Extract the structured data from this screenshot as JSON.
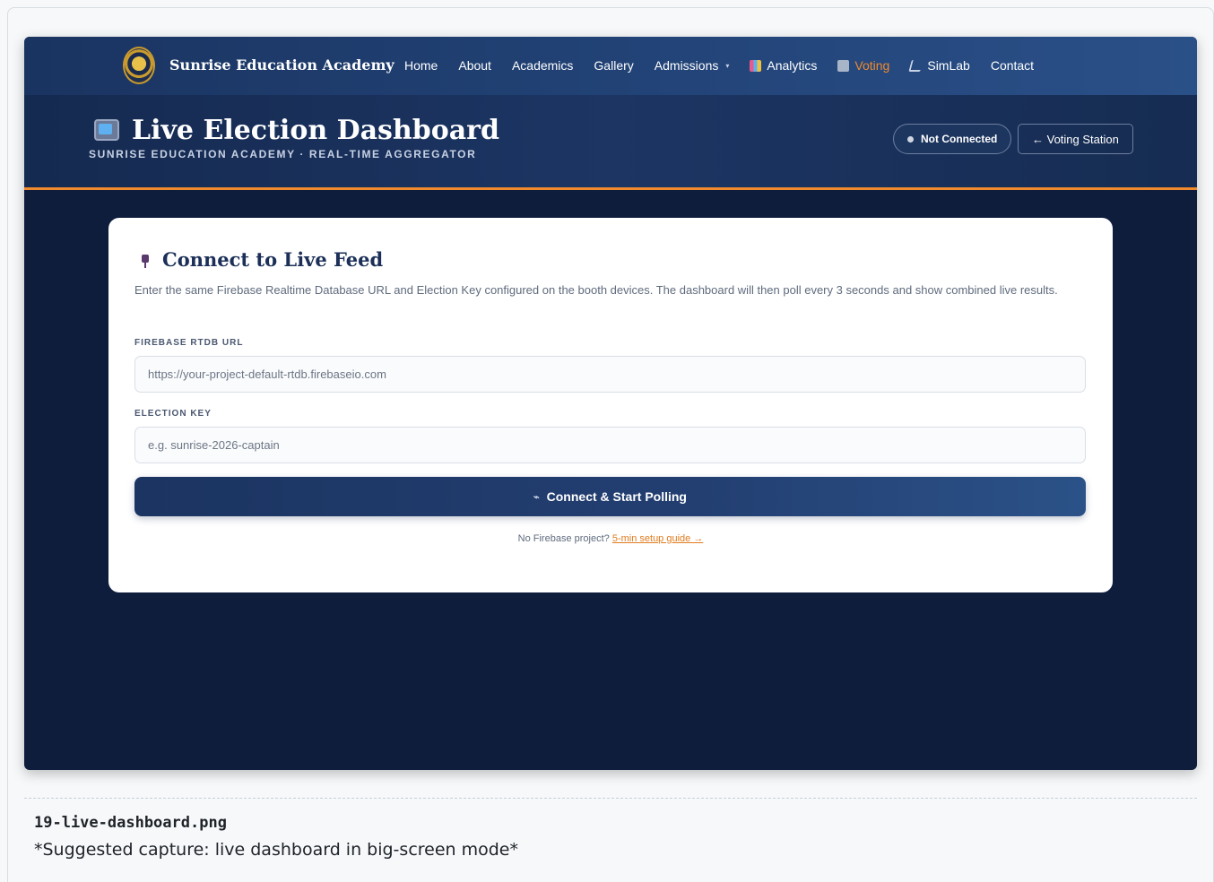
{
  "nav": {
    "brand": "Sunrise Education Academy",
    "links": [
      {
        "label": "Home"
      },
      {
        "label": "About"
      },
      {
        "label": "Academics"
      },
      {
        "label": "Gallery"
      },
      {
        "label": "Admissions",
        "caret": "▾"
      },
      {
        "label": "Analytics",
        "icon": "bar-chart-icon"
      },
      {
        "label": "Voting",
        "icon": "ballot-box-icon",
        "active": true
      },
      {
        "label": "SimLab",
        "icon": "microscope-icon"
      },
      {
        "label": "Contact"
      }
    ]
  },
  "header": {
    "title": "Live Election Dashboard",
    "subtitle": "SUNRISE EDUCATION ACADEMY · REAL-TIME AGGREGATOR",
    "status": "Not Connected",
    "back_button": "← Voting Station",
    "icon": "television-icon"
  },
  "card": {
    "title": "Connect to Live Feed",
    "icon": "plug-icon",
    "description": "Enter the same Firebase Realtime Database URL and Election Key configured on the booth devices. The dashboard will then poll every 3 seconds and show combined live results.",
    "url_label": "FIREBASE RTDB URL",
    "url_placeholder": "https://your-project-default-rtdb.firebaseio.com",
    "key_label": "ELECTION KEY",
    "key_placeholder": "e.g. sunrise-2026-captain",
    "connect_button": "Connect & Start Polling",
    "setup_text": "No Firebase project?",
    "setup_link": "5-min setup guide →"
  },
  "footer": {
    "filename": "19-live-dashboard.png",
    "caption": "*Suggested capture: live dashboard in big-screen mode*"
  },
  "colors": {
    "accent": "#f08a2c",
    "navy": "#1b3461",
    "background": "#0f1d3d"
  }
}
